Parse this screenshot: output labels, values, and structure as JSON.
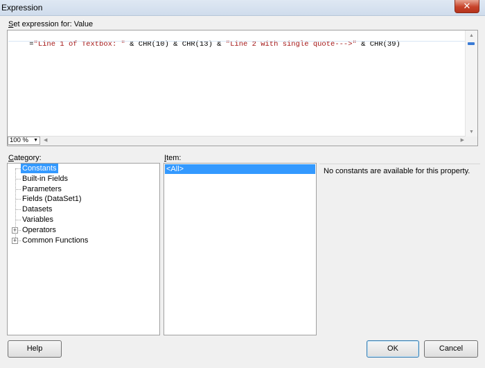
{
  "window": {
    "title": "Expression",
    "close_glyph": "✕"
  },
  "editor": {
    "label_prefix": "S",
    "label_rest": "et expression for: Value",
    "expression_segments": [
      {
        "text": "=",
        "kind": "op"
      },
      {
        "text": "\"Line 1 of Textbox: \"",
        "kind": "str"
      },
      {
        "text": " & CHR(10) & CHR(13) & ",
        "kind": "op"
      },
      {
        "text": "\"Line 2 with single quote--->\"",
        "kind": "str"
      },
      {
        "text": " & CHR(39)",
        "kind": "op"
      }
    ],
    "zoom": "100 %"
  },
  "category": {
    "label_prefix": "C",
    "label_rest": "ategory:",
    "items": [
      {
        "label": "Constants",
        "selected": true,
        "expandable": false
      },
      {
        "label": "Built-in Fields",
        "selected": false,
        "expandable": false
      },
      {
        "label": "Parameters",
        "selected": false,
        "expandable": false
      },
      {
        "label": "Fields (DataSet1)",
        "selected": false,
        "expandable": false
      },
      {
        "label": "Datasets",
        "selected": false,
        "expandable": false
      },
      {
        "label": "Variables",
        "selected": false,
        "expandable": false
      },
      {
        "label": "Operators",
        "selected": false,
        "expandable": true
      },
      {
        "label": "Common Functions",
        "selected": false,
        "expandable": true
      }
    ]
  },
  "item": {
    "label_prefix": "I",
    "label_rest": "tem:",
    "rows": [
      "<All>"
    ]
  },
  "description": "No constants are available for this property.",
  "buttons": {
    "help": "Help",
    "ok": "OK",
    "cancel": "Cancel"
  }
}
